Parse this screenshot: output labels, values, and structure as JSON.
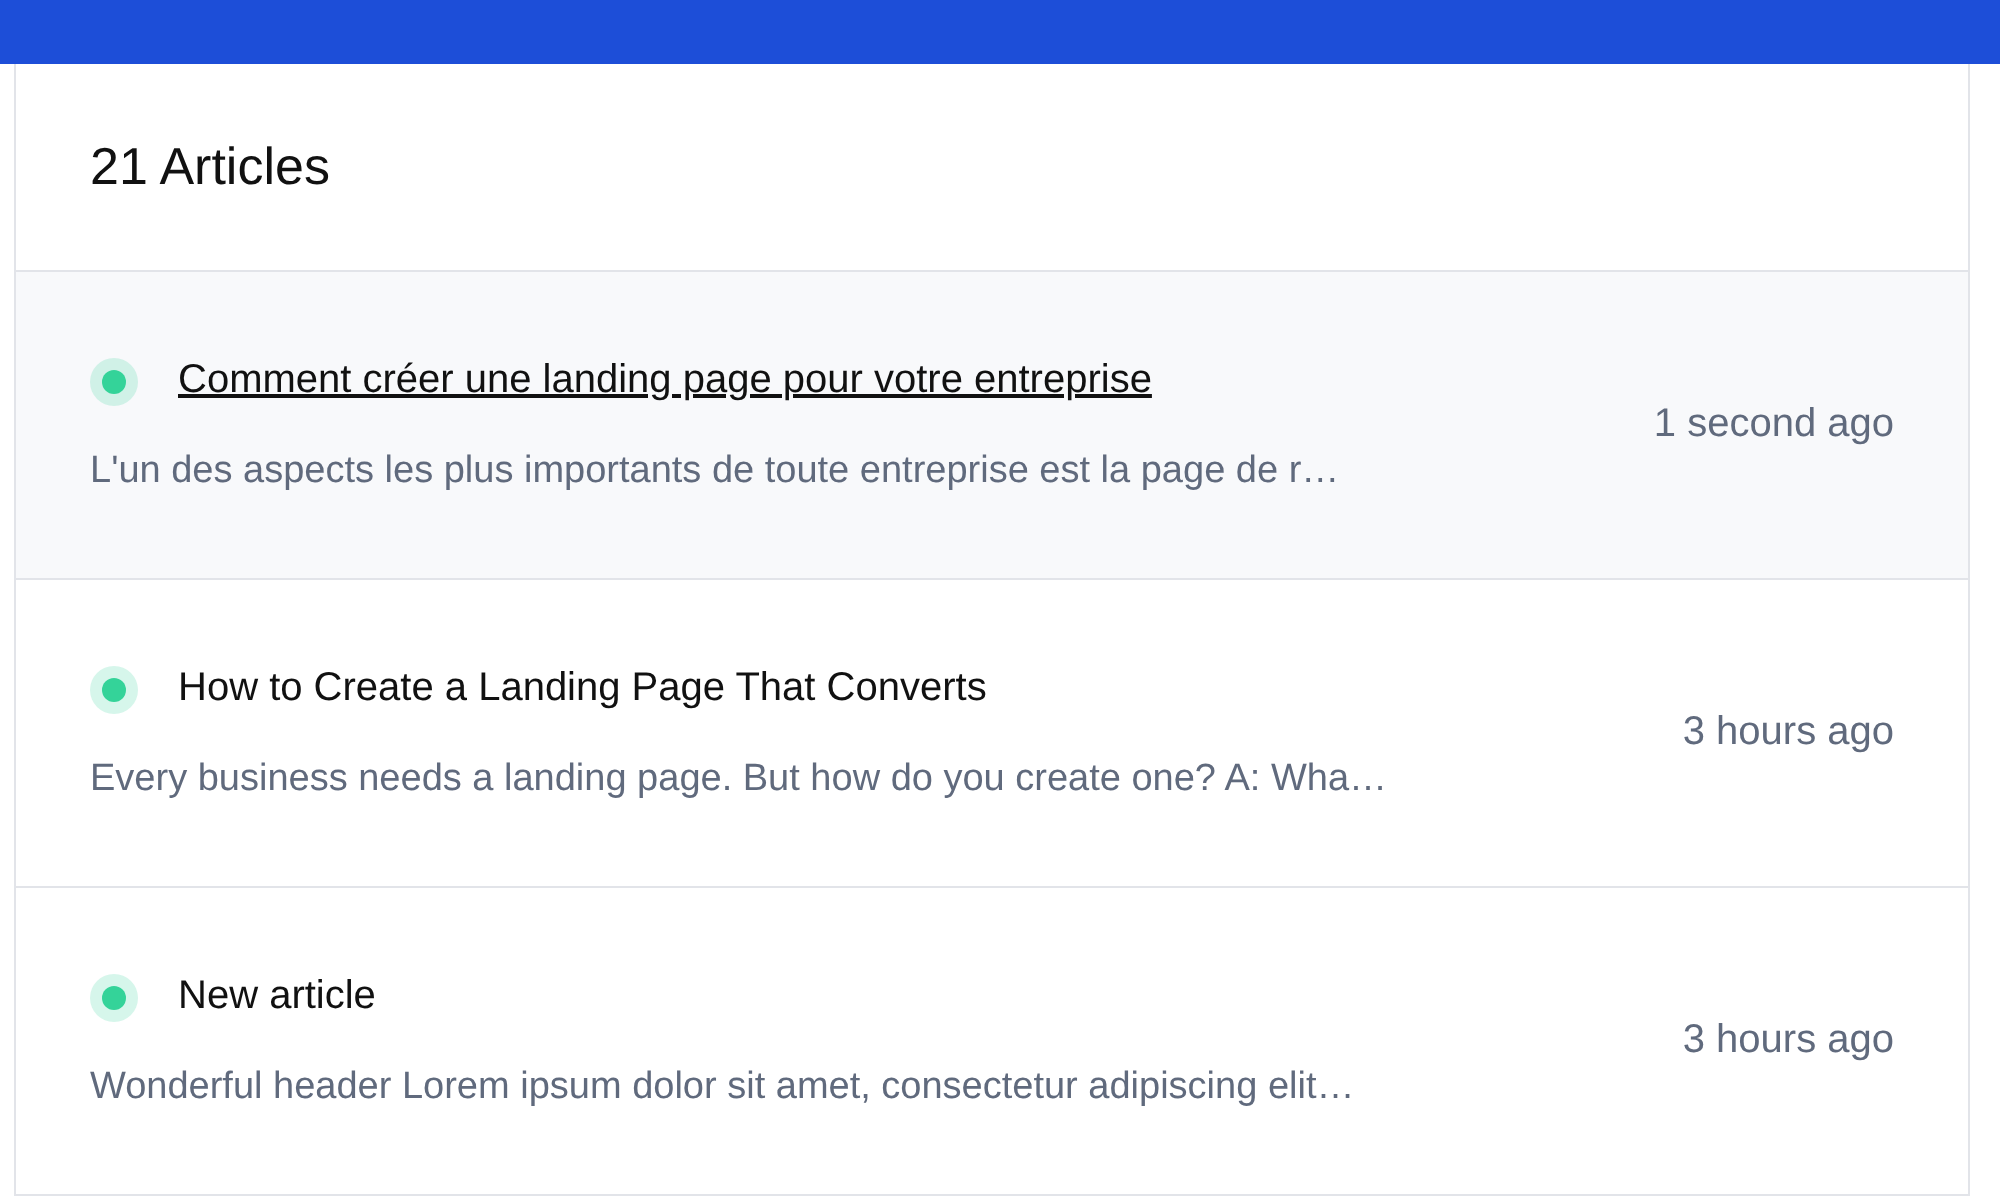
{
  "header": {
    "title": "21 Articles"
  },
  "articles": [
    {
      "title": "Comment créer une landing page pour votre entreprise",
      "excerpt": "L'un des aspects les plus importants de toute entreprise est la page de r…",
      "time": "1 second ago",
      "color": "#34d399",
      "highlighted": true
    },
    {
      "title": "How to Create a Landing Page That Converts",
      "excerpt": "Every business needs a landing page. But how do you create one? A: Wha…",
      "time": "3 hours ago",
      "color": "#34d399",
      "highlighted": false
    },
    {
      "title": "New article",
      "excerpt": "Wonderful header Lorem ipsum dolor sit amet, consectetur adipiscing elit…",
      "time": "3 hours ago",
      "color": "#34d399",
      "highlighted": false
    }
  ]
}
